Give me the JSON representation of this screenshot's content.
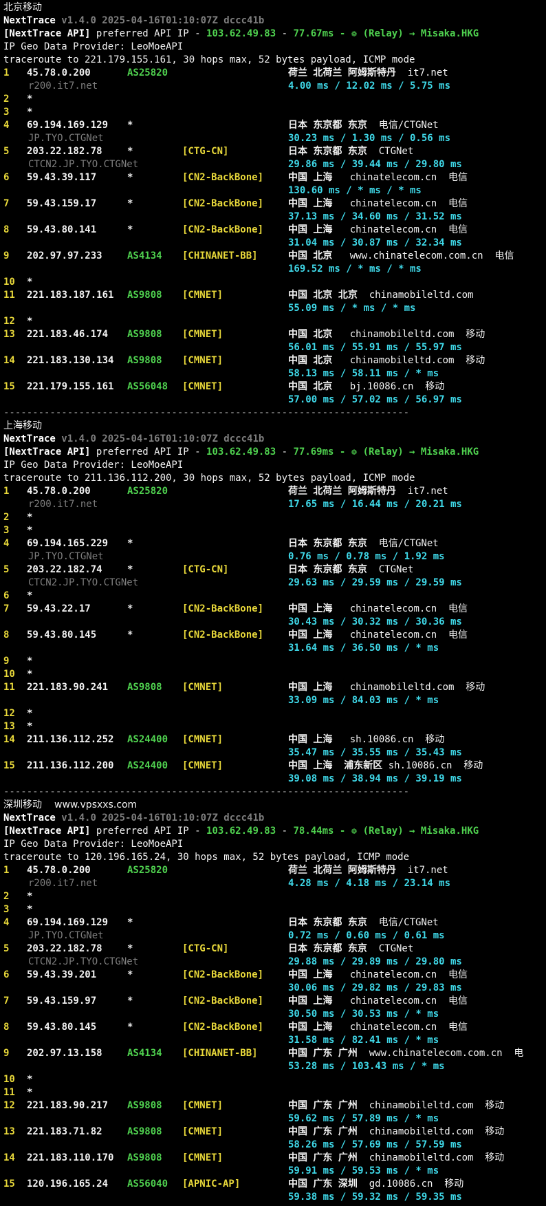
{
  "divider": "----------------------------------------------------------------------",
  "sections": [
    {
      "title": "北京移动",
      "site": "",
      "header": {
        "app": "NextTrace",
        "version": "v1.4.0 2025-04-16T01:10:07Z dccc41b",
        "api_tag": "[NextTrace API]",
        "api_text": " preferred API IP - ",
        "api_ip": "103.62.49.83",
        "api_sep": " - ",
        "api_ms": "77.67ms",
        "api_relay": " - ❁ (Relay) → Misaka.HKG",
        "geo_provider": "IP Geo Data Provider: LeoMoeAPI",
        "traceroute": "traceroute to 221.179.155.161, 30 hops max, 52 bytes payload, ICMP mode"
      },
      "hops": [
        {
          "n": "1",
          "ip": "45.78.0.200",
          "asn": "AS25820",
          "tag": "",
          "geo": "荷兰 北荷兰 阿姆斯特丹",
          "geo_extra": "  it7.net",
          "host": "r200.it7.net",
          "rtt": "4.00 ms / 12.02 ms / 5.75 ms"
        },
        {
          "n": "2",
          "star": "*"
        },
        {
          "n": "3",
          "star": "*"
        },
        {
          "n": "4",
          "ip": "69.194.169.129",
          "asn": "*",
          "tag": "",
          "geo": "日本 东京都 东京",
          "geo_extra": "  电信/CTGNet",
          "host": "JP.TYO.CTGNet",
          "rtt": "30.23 ms / 1.30 ms / 0.56 ms"
        },
        {
          "n": "5",
          "ip": "203.22.182.78",
          "asn": "*",
          "tag": "[CTG-CN]",
          "geo": "日本 东京都 东京",
          "geo_extra": "  CTGNet",
          "host": "CTCN2.JP.TYO.CTGNet",
          "rtt": "29.86 ms / 39.44 ms / 29.80 ms"
        },
        {
          "n": "6",
          "ip": "59.43.39.117",
          "asn": "*",
          "tag": "[CN2-BackBone]",
          "geo": "中国 上海",
          "geo_extra": "   chinatelecom.cn  电信",
          "host": "",
          "rtt": "130.60 ms / * ms / * ms"
        },
        {
          "n": "7",
          "ip": "59.43.159.17",
          "asn": "*",
          "tag": "[CN2-BackBone]",
          "geo": "中国 上海",
          "geo_extra": "   chinatelecom.cn  电信",
          "host": "",
          "rtt": "37.13 ms / 34.60 ms / 31.52 ms"
        },
        {
          "n": "8",
          "ip": "59.43.80.141",
          "asn": "*",
          "tag": "[CN2-BackBone]",
          "geo": "中国 上海",
          "geo_extra": "   chinatelecom.cn  电信",
          "host": "",
          "rtt": "31.04 ms / 30.87 ms / 32.34 ms"
        },
        {
          "n": "9",
          "ip": "202.97.97.233",
          "asn": "AS4134",
          "tag": "[CHINANET-BB]",
          "geo": "中国 北京",
          "geo_extra": "   www.chinatelecom.com.cn  电信",
          "host": "",
          "rtt": "169.52 ms / * ms / * ms"
        },
        {
          "n": "10",
          "star": "*"
        },
        {
          "n": "11",
          "ip": "221.183.187.161",
          "asn": "AS9808",
          "tag": "[CMNET]",
          "geo": "中国 北京 北京",
          "geo_extra": "  chinamobileltd.com",
          "host": "",
          "rtt": "55.09 ms / * ms / * ms"
        },
        {
          "n": "12",
          "star": "*"
        },
        {
          "n": "13",
          "ip": "221.183.46.174",
          "asn": "AS9808",
          "tag": "[CMNET]",
          "geo": "中国 北京",
          "geo_extra": "   chinamobileltd.com  移动",
          "host": "",
          "rtt": "56.01 ms / 55.91 ms / 55.97 ms"
        },
        {
          "n": "14",
          "ip": "221.183.130.134",
          "asn": "AS9808",
          "tag": "[CMNET]",
          "geo": "中国 北京",
          "geo_extra": "   chinamobileltd.com  移动",
          "host": "",
          "rtt": "58.13 ms / 58.11 ms / * ms"
        },
        {
          "n": "15",
          "ip": "221.179.155.161",
          "asn": "AS56048",
          "tag": "[CMNET]",
          "geo": "中国 北京",
          "geo_extra": "   bj.10086.cn  移动",
          "host": "",
          "rtt": "57.00 ms / 57.02 ms / 56.97 ms"
        }
      ]
    },
    {
      "title": "上海移动",
      "site": "",
      "header": {
        "app": "NextTrace",
        "version": "v1.4.0 2025-04-16T01:10:07Z dccc41b",
        "api_tag": "[NextTrace API]",
        "api_text": " preferred API IP - ",
        "api_ip": "103.62.49.83",
        "api_sep": " - ",
        "api_ms": "77.69ms",
        "api_relay": " - ❁ (Relay) → Misaka.HKG",
        "geo_provider": "IP Geo Data Provider: LeoMoeAPI",
        "traceroute": "traceroute to 211.136.112.200, 30 hops max, 52 bytes payload, ICMP mode"
      },
      "hops": [
        {
          "n": "1",
          "ip": "45.78.0.200",
          "asn": "AS25820",
          "tag": "",
          "geo": "荷兰 北荷兰 阿姆斯特丹",
          "geo_extra": "  it7.net",
          "host": "r200.it7.net",
          "rtt": "17.65 ms / 16.44 ms / 20.21 ms"
        },
        {
          "n": "2",
          "star": "*"
        },
        {
          "n": "3",
          "star": "*"
        },
        {
          "n": "4",
          "ip": "69.194.165.229",
          "asn": "*",
          "tag": "",
          "geo": "日本 东京都 东京",
          "geo_extra": "  电信/CTGNet",
          "host": "JP.TYO.CTGNet",
          "rtt": "0.76 ms / 0.78 ms / 1.92 ms"
        },
        {
          "n": "5",
          "ip": "203.22.182.74",
          "asn": "*",
          "tag": "[CTG-CN]",
          "geo": "日本 东京都 东京",
          "geo_extra": "  CTGNet",
          "host": "CTCN2.JP.TYO.CTGNet",
          "rtt": "29.63 ms / 29.59 ms / 29.59 ms"
        },
        {
          "n": "6",
          "star": "*"
        },
        {
          "n": "7",
          "ip": "59.43.22.17",
          "asn": "*",
          "tag": "[CN2-BackBone]",
          "geo": "中国 上海",
          "geo_extra": "   chinatelecom.cn  电信",
          "host": "",
          "rtt": "30.43 ms / 30.32 ms / 30.36 ms"
        },
        {
          "n": "8",
          "ip": "59.43.80.145",
          "asn": "*",
          "tag": "[CN2-BackBone]",
          "geo": "中国 上海",
          "geo_extra": "   chinatelecom.cn  电信",
          "host": "",
          "rtt": "31.64 ms / 36.50 ms / * ms"
        },
        {
          "n": "9",
          "star": "*"
        },
        {
          "n": "10",
          "star": "*"
        },
        {
          "n": "11",
          "ip": "221.183.90.241",
          "asn": "AS9808",
          "tag": "[CMNET]",
          "geo": "中国 上海",
          "geo_extra": "   chinamobileltd.com  移动",
          "host": "",
          "rtt": "33.09 ms / 84.03 ms / * ms"
        },
        {
          "n": "12",
          "star": "*"
        },
        {
          "n": "13",
          "star": "*"
        },
        {
          "n": "14",
          "ip": "211.136.112.252",
          "asn": "AS24400",
          "tag": "[CMNET]",
          "geo": "中国 上海",
          "geo_extra": "   sh.10086.cn  移动",
          "host": "",
          "rtt": "35.47 ms / 35.55 ms / 35.43 ms"
        },
        {
          "n": "15",
          "ip": "211.136.112.200",
          "asn": "AS24400",
          "tag": "[CMNET]",
          "geo": "中国 上海  浦东新区",
          "geo_extra": " sh.10086.cn  移动",
          "host": "",
          "rtt": "39.08 ms / 38.94 ms / 39.19 ms"
        }
      ]
    },
    {
      "title": "深圳移动",
      "site": "www.vpsxxs.com",
      "header": {
        "app": "NextTrace",
        "version": "v1.4.0 2025-04-16T01:10:07Z dccc41b",
        "api_tag": "[NextTrace API]",
        "api_text": " preferred API IP - ",
        "api_ip": "103.62.49.83",
        "api_sep": " - ",
        "api_ms": "78.44ms",
        "api_relay": " - ❁ (Relay) → Misaka.HKG",
        "geo_provider": "IP Geo Data Provider: LeoMoeAPI",
        "traceroute": "traceroute to 120.196.165.24, 30 hops max, 52 bytes payload, ICMP mode"
      },
      "hops": [
        {
          "n": "1",
          "ip": "45.78.0.200",
          "asn": "AS25820",
          "tag": "",
          "geo": "荷兰 北荷兰 阿姆斯特丹",
          "geo_extra": "  it7.net",
          "host": "r200.it7.net",
          "rtt": "4.28 ms / 4.18 ms / 23.14 ms"
        },
        {
          "n": "2",
          "star": "*"
        },
        {
          "n": "3",
          "star": "*"
        },
        {
          "n": "4",
          "ip": "69.194.169.129",
          "asn": "*",
          "tag": "",
          "geo": "日本 东京都 东京",
          "geo_extra": "  电信/CTGNet",
          "host": "JP.TYO.CTGNet",
          "rtt": "0.72 ms / 0.60 ms / 0.61 ms"
        },
        {
          "n": "5",
          "ip": "203.22.182.78",
          "asn": "*",
          "tag": "[CTG-CN]",
          "geo": "日本 东京都 东京",
          "geo_extra": "  CTGNet",
          "host": "CTCN2.JP.TYO.CTGNet",
          "rtt": "29.88 ms / 29.89 ms / 29.80 ms"
        },
        {
          "n": "6",
          "ip": "59.43.39.201",
          "asn": "*",
          "tag": "[CN2-BackBone]",
          "geo": "中国 上海",
          "geo_extra": "   chinatelecom.cn  电信",
          "host": "",
          "rtt": "30.06 ms / 29.82 ms / 29.83 ms"
        },
        {
          "n": "7",
          "ip": "59.43.159.97",
          "asn": "*",
          "tag": "[CN2-BackBone]",
          "geo": "中国 上海",
          "geo_extra": "   chinatelecom.cn  电信",
          "host": "",
          "rtt": "30.50 ms / 30.53 ms / * ms"
        },
        {
          "n": "8",
          "ip": "59.43.80.145",
          "asn": "*",
          "tag": "[CN2-BackBone]",
          "geo": "中国 上海",
          "geo_extra": "   chinatelecom.cn  电信",
          "host": "",
          "rtt": "31.58 ms / 82.41 ms / * ms"
        },
        {
          "n": "9",
          "ip": "202.97.13.158",
          "asn": "AS4134",
          "tag": "[CHINANET-BB]",
          "geo": "中国 广东 广州",
          "geo_extra": "  www.chinatelecom.com.cn  电",
          "host": "",
          "rtt": "53.28 ms / 103.43 ms / * ms"
        },
        {
          "n": "10",
          "star": "*"
        },
        {
          "n": "11",
          "star": "*"
        },
        {
          "n": "12",
          "ip": "221.183.90.217",
          "asn": "AS9808",
          "tag": "[CMNET]",
          "geo": "中国 广东 广州",
          "geo_extra": "  chinamobileltd.com  移动",
          "host": "",
          "rtt": "59.62 ms / 57.89 ms / * ms"
        },
        {
          "n": "13",
          "ip": "221.183.71.82",
          "asn": "AS9808",
          "tag": "[CMNET]",
          "geo": "中国 广东 广州",
          "geo_extra": "  chinamobileltd.com  移动",
          "host": "",
          "rtt": "58.26 ms / 57.69 ms / 57.59 ms"
        },
        {
          "n": "14",
          "ip": "221.183.110.170",
          "asn": "AS9808",
          "tag": "[CMNET]",
          "geo": "中国 广东 广州",
          "geo_extra": "  chinamobileltd.com  移动",
          "host": "",
          "rtt": "59.91 ms / 59.53 ms / * ms"
        },
        {
          "n": "15",
          "ip": "120.196.165.24",
          "asn": "AS56040",
          "tag": "[APNIC-AP]",
          "geo": "中国 广东 深圳",
          "geo_extra": "  gd.10086.cn  移动",
          "host": "",
          "rtt": "59.38 ms / 59.32 ms / 59.35 ms"
        }
      ]
    }
  ]
}
